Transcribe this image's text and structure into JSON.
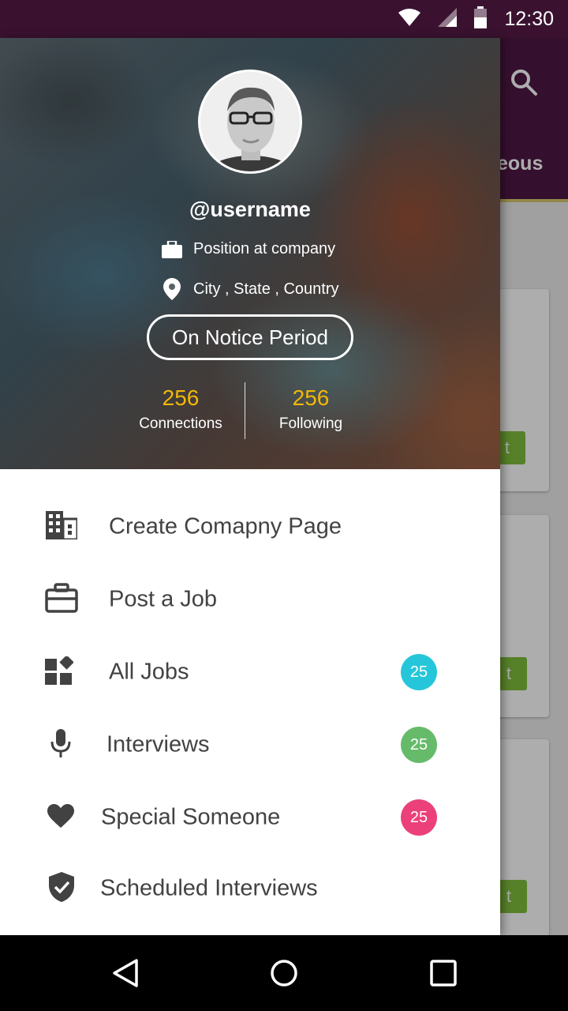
{
  "status_bar": {
    "time": "12:30"
  },
  "background": {
    "tab_partial": "eous",
    "button_partial": "t"
  },
  "drawer": {
    "header": {
      "username": "@username",
      "position": "Position at company",
      "location": "City , State , Country",
      "status_button": "On Notice Period",
      "stats": [
        {
          "value": "256",
          "label": "Connections"
        },
        {
          "value": "256",
          "label": "Following"
        }
      ]
    },
    "menu": [
      {
        "label": "Create Comapny Page",
        "icon": "building-icon"
      },
      {
        "label": "Post a Job",
        "icon": "briefcase-icon"
      },
      {
        "label": "All Jobs",
        "icon": "widgets-icon",
        "badge": "25",
        "badge_color": "#26c6da"
      },
      {
        "label": "Interviews",
        "icon": "mic-icon",
        "badge": "25",
        "badge_color": "#66bb6a"
      },
      {
        "label": "Special Someone",
        "icon": "heart-icon",
        "badge": "25",
        "badge_color": "#ec407a"
      },
      {
        "label": "Scheduled Interviews",
        "icon": "shield-check-icon"
      }
    ]
  },
  "colors": {
    "status_bar": "#3a1230",
    "app_bar": "#4e1745",
    "stat_number": "#f2b705",
    "action_button": "#7fbf3b"
  }
}
